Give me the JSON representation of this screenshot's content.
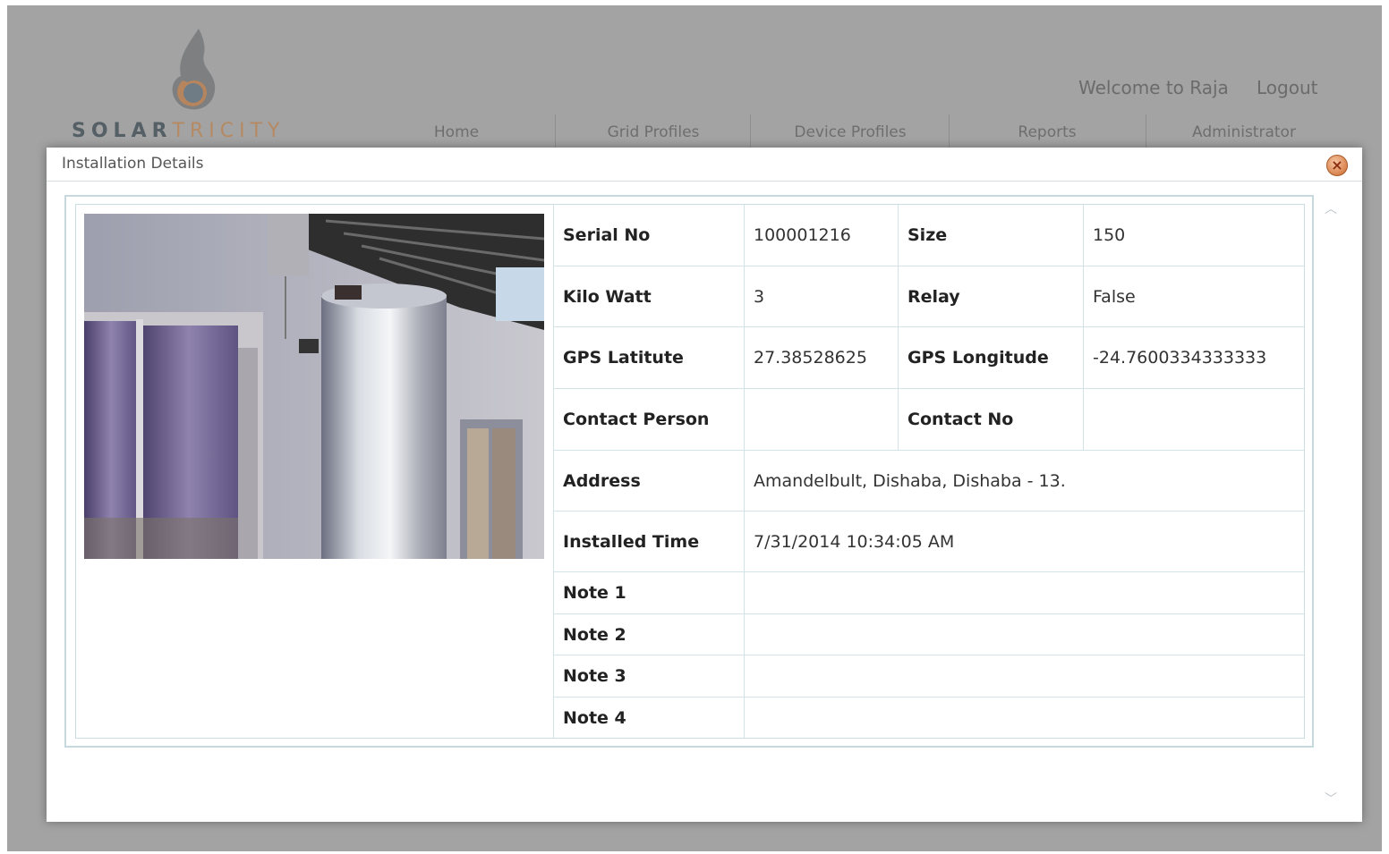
{
  "header": {
    "brand_part1": "SOLAR",
    "brand_part2": "TRICITY",
    "welcome": "Welcome to Raja",
    "logout": "Logout",
    "nav": [
      "Home",
      "Grid Profiles",
      "Device Profiles",
      "Reports",
      "Administrator"
    ]
  },
  "modal": {
    "title": "Installation Details",
    "rows": [
      {
        "l1": "Serial No",
        "v1": "100001216",
        "l2": "Size",
        "v2": "150"
      },
      {
        "l1": "Kilo Watt",
        "v1": "3",
        "l2": "Relay",
        "v2": "False"
      },
      {
        "l1": "GPS Latitute",
        "v1": "27.38528625",
        "l2": "GPS Longitude",
        "v2": "-24.7600334333333"
      },
      {
        "l1": "Contact Person",
        "v1": "",
        "l2": "Contact No",
        "v2": ""
      }
    ],
    "address_label": "Address",
    "address_value": "Amandelbult, Dishaba, Dishaba - 13.",
    "installed_label": "Installed Time",
    "installed_value": "7/31/2014 10:34:05 AM",
    "notes": [
      {
        "label": "Note 1",
        "value": ""
      },
      {
        "label": "Note 2",
        "value": ""
      },
      {
        "label": "Note 3",
        "value": ""
      },
      {
        "label": "Note 4",
        "value": ""
      }
    ]
  },
  "icons": {
    "logo": "flame-logo-icon",
    "close": "close-icon",
    "scroll_up": "chevron-up-icon",
    "scroll_down": "chevron-down-icon"
  },
  "colors": {
    "overlay": "#a3a3a3",
    "modal_border": "#c7d9dd",
    "close_button": "#d9844f"
  }
}
